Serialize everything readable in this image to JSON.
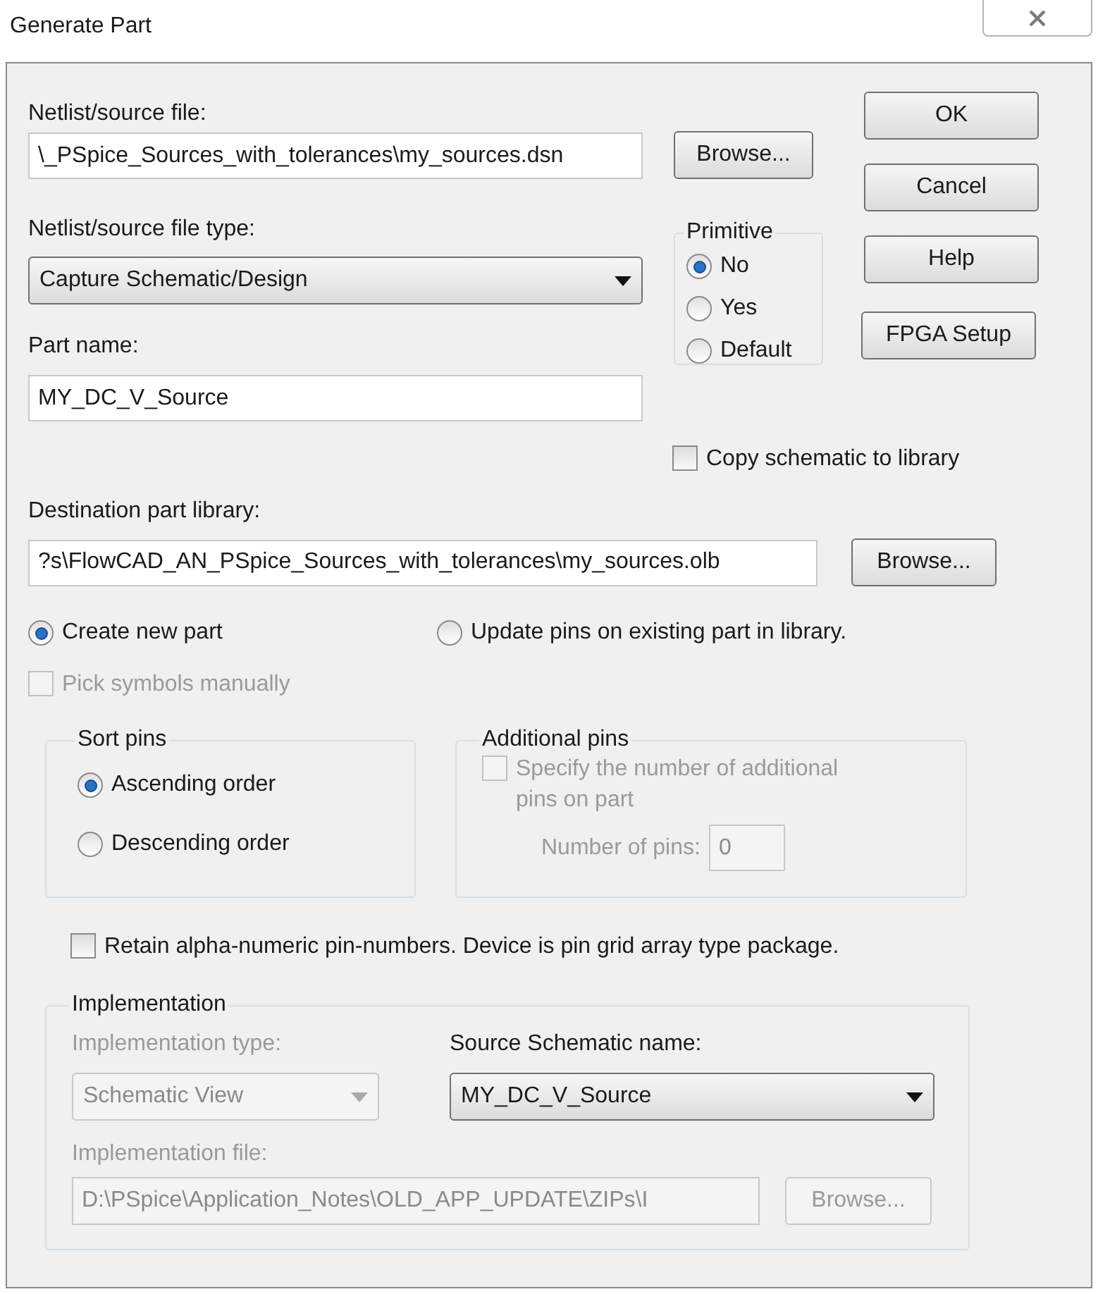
{
  "window": {
    "title": "Generate Part"
  },
  "netlist_source_file": {
    "label": "Netlist/source file:",
    "value": "\\_PSpice_Sources_with_tolerances\\my_sources.dsn",
    "browse": "Browse..."
  },
  "buttons": [
    {
      "label": "OK"
    },
    {
      "label": "Cancel"
    },
    {
      "label": "Help"
    },
    {
      "label": "FPGA Setup"
    }
  ],
  "netlist_file_type": {
    "label": "Netlist/source file type:",
    "value": "Capture Schematic/Design"
  },
  "primitive": {
    "title": "Primitive",
    "options": [
      {
        "label": "No",
        "selected": true
      },
      {
        "label": "Yes",
        "selected": false
      },
      {
        "label": "Default",
        "selected": false
      }
    ]
  },
  "part_name": {
    "label": "Part name:",
    "value": "MY_DC_V_Source"
  },
  "copy_schematic": {
    "label": "Copy schematic to library",
    "checked": false
  },
  "destination_library": {
    "label": "Destination part library:",
    "value": "?s\\FlowCAD_AN_PSpice_Sources_with_tolerances\\my_sources.olb",
    "browse": "Browse..."
  },
  "create_mode": [
    {
      "label": "Create new part",
      "selected": true
    },
    {
      "label": "Update pins on existing part in library.",
      "selected": false
    }
  ],
  "pick_symbols": {
    "label": "Pick symbols manually",
    "checked": false,
    "disabled": true
  },
  "sort_pins": {
    "title": "Sort pins",
    "options": [
      {
        "label": "Ascending order",
        "selected": true
      },
      {
        "label": "Descending order",
        "selected": false
      }
    ]
  },
  "additional_pins": {
    "title": "Additional pins",
    "checkbox": {
      "label": "Specify the number of additional pins on part",
      "checked": false
    },
    "number_label": "Number of pins:",
    "number_value": "0",
    "disabled": true
  },
  "retain_alpha": {
    "label": "Retain alpha-numeric pin-numbers. Device is pin grid array type package.",
    "checked": false
  },
  "implementation": {
    "title": "Implementation",
    "type": {
      "label": "Implementation type:",
      "value": "Schematic View",
      "disabled": true
    },
    "source_schematic": {
      "label": "Source Schematic name:",
      "value": "MY_DC_V_Source"
    },
    "file": {
      "label": "Implementation file:",
      "value": "D:\\PSpice\\Application_Notes\\OLD_APP_UPDATE\\ZIPs\\I",
      "disabled": true
    },
    "browse": {
      "label": "Browse...",
      "disabled": true
    }
  }
}
